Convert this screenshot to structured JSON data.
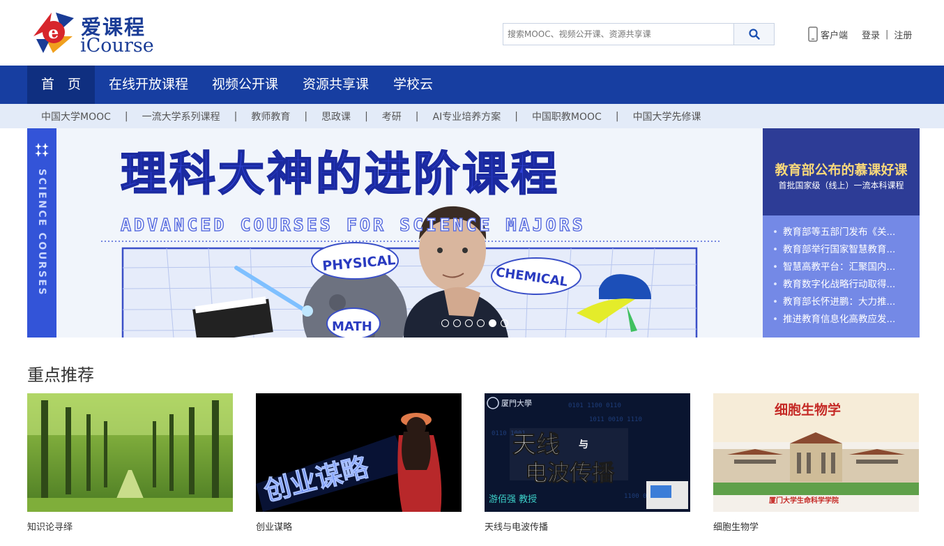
{
  "header": {
    "logo_cn": "爱课程",
    "logo_en": "iCourse",
    "search_placeholder": "搜索MOOC、视频公开课、资源共享课",
    "client_label": "客户端",
    "login_label": "登录",
    "register_label": "注册",
    "divider": "|"
  },
  "nav": {
    "items": [
      {
        "label": "首　页",
        "active": true
      },
      {
        "label": "在线开放课程"
      },
      {
        "label": "视频公开课"
      },
      {
        "label": "资源共享课"
      },
      {
        "label": "学校云"
      }
    ]
  },
  "subnav": {
    "items": [
      "中国大学MOOC",
      "一流大学系列课程",
      "教师教育",
      "思政课",
      "考研",
      "AI专业培养方案",
      "中国职教MOOC",
      "中国大学先修课"
    ],
    "separator": "|"
  },
  "banner": {
    "side_text": "SCIENCE COURSES",
    "title": "理科大神的进阶课程",
    "subtitle": "ADVANCED COURSES FOR SCIENCE MAJORS",
    "bubbles": [
      "PHYSICAL",
      "CHEMICAL",
      "MATH"
    ],
    "slide_count": 6,
    "active_slide": 5
  },
  "news": {
    "head_title": "教育部公布的慕课好课",
    "head_sub": "首批国家级（线上）一流本科课程",
    "items": [
      "教育部等五部门发布《关...",
      "教育部举行国家智慧教育...",
      "智慧高教平台：汇聚国内...",
      "教育数字化战略行动取得...",
      "教育部长怀进鹏：大力推...",
      "推进教育信息化高教应发..."
    ]
  },
  "recommend": {
    "title": "重点推荐",
    "cards": [
      {
        "caption": "知识论寻绎"
      },
      {
        "caption": "创业谋略",
        "image_text": "创业谋略"
      },
      {
        "caption": "天线与电波传播",
        "image_school": "厦門大學",
        "image_title_1": "天线",
        "image_title_small": "与",
        "image_title_2": "电波传播",
        "image_teacher": "游佰强 教授"
      },
      {
        "caption": "细胞生物学",
        "image_title": "细胞生物学",
        "image_footer": "厦门大学生命科学学院"
      }
    ]
  },
  "colors": {
    "nav_bg": "#173ea1",
    "nav_active": "#0f2f80",
    "subnav_bg": "#e3ebf8",
    "brand": "#1a3c96"
  }
}
